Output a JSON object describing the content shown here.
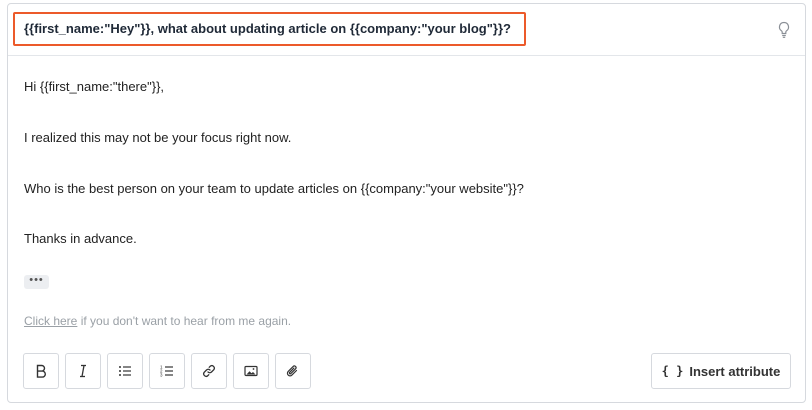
{
  "subject": {
    "text": "{{first_name:\"Hey\"}}, what about updating article on {{company:\"your blog\"}}?"
  },
  "body": {
    "greeting": "Hi {{first_name:\"there\"}},",
    "line1": "I realized this may not be your focus right now.",
    "line2": "Who is the best person on your team to update articles on {{company:\"your website\"}}?",
    "closing": "Thanks in advance.",
    "collapsed_indicator": "•••"
  },
  "unsubscribe": {
    "link_text": "Click here",
    "rest_text": " if you don't want to hear from me again."
  },
  "toolbar": {
    "bold_icon": "bold-icon",
    "italic_icon": "italic-icon",
    "bullet_list_icon": "bullet-list-icon",
    "numbered_list_icon": "numbered-list-icon",
    "link_icon": "link-icon",
    "image_icon": "image-icon",
    "attachment_icon": "paperclip-icon",
    "insert_attribute_label": "Insert attribute",
    "insert_attribute_icon": "{ }"
  },
  "colors": {
    "highlight_border": "#ec5a2a",
    "border": "#d6d9de"
  }
}
